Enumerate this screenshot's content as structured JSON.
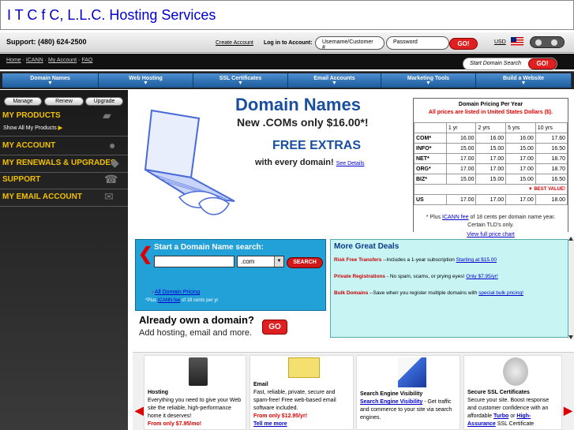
{
  "window": {
    "title": "I T C f C, L.L.C. Hosting Services"
  },
  "topbar": {
    "support": "Support: (480) 624-2500",
    "create_account": "Create Account",
    "login_label": "Log in to Account:",
    "username_placeholder": "Username/Customer #",
    "password_placeholder": "Password",
    "go_label": "GO!",
    "currency": "USD"
  },
  "breadcrumbs": {
    "home": "Home",
    "icann": "ICANN",
    "my_account": "My Account",
    "faq": "FAQ"
  },
  "domain_search_pill": {
    "label": "Start Domain Search",
    "go": "GO!"
  },
  "menu": [
    {
      "label": "Domain Names"
    },
    {
      "label": "Web Hosting"
    },
    {
      "label": "SSL Certificates"
    },
    {
      "label": "Email Accounts"
    },
    {
      "label": "Marketing Tools"
    },
    {
      "label": "Build a Website"
    }
  ],
  "sidebar": {
    "buttons": [
      "Manage",
      "Renew",
      "Upgrade"
    ],
    "my_products": "MY PRODUCTS",
    "show_all": "Show All My Products",
    "my_account": "MY ACCOUNT",
    "renewals": "MY RENEWALS & UPGRADES",
    "support": "SUPPORT",
    "email": "MY EMAIL ACCOUNT"
  },
  "hero": {
    "title": "Domain Names",
    "subtitle": "New .COMs only $16.00*!",
    "free": "FREE EXTRAS",
    "free_sub": "with every domain!",
    "see_details": "See Details"
  },
  "pricing": {
    "title": "Domain Pricing Per Year",
    "subtitle": "All prices are listed in United States Dollars ($).",
    "columns": [
      "1 yr",
      "2 yrs",
      "5 yrs",
      "10 yrs"
    ],
    "rows": [
      {
        "tld": "COM*",
        "p": [
          "16.00",
          "16.00",
          "16.00",
          "17.60"
        ]
      },
      {
        "tld": "INFO*",
        "p": [
          "15.00",
          "15.00",
          "15.00",
          "16.50"
        ]
      },
      {
        "tld": "NET*",
        "p": [
          "17.00",
          "17.00",
          "17.00",
          "18.70"
        ]
      },
      {
        "tld": "ORG*",
        "p": [
          "17.00",
          "17.00",
          "17.00",
          "18.70"
        ]
      },
      {
        "tld": "BIZ*",
        "p": [
          "15.00",
          "15.00",
          "15.00",
          "16.50"
        ]
      },
      {
        "tld": "US",
        "p": [
          "17.00",
          "17.00",
          "17.00",
          "18.00"
        ]
      }
    ],
    "best_value": "BEST VALUE!",
    "note_prefix": "* Plus",
    "note_link": "ICANN fee",
    "note_suffix": "of 18 cents per domain name year.",
    "note_2": "Certain TLD's only.",
    "view_all": "View full price chart"
  },
  "search": {
    "title": "Start a Domain Name search:",
    "tld": ".com",
    "button": "SEARCH",
    "all_pricing": "All Domain Pricing",
    "icann_prefix": "*Plus",
    "icann_link": "ICANN fee",
    "icann_suffix": "of 18 cents per yr"
  },
  "already": {
    "title": "Already own a domain?",
    "sub": "Add hosting, email and more.",
    "go": "GO"
  },
  "deals": {
    "title": "More Great Deals",
    "items": [
      {
        "name": "Risk Free Transfers",
        "text": "--Includes a 1-year subscription",
        "link": "Starting at $15.00"
      },
      {
        "name": "Private Registrations",
        "text": "- No spam, scams, or prying eyes!",
        "link": "Only $7.95/yr!"
      },
      {
        "name": "Bulk Domains",
        "text": "--Save when you register multiple domains with",
        "link": "special bulk pricing!"
      }
    ]
  },
  "cards": [
    {
      "title": "Hosting",
      "text": "Everything you need to give your Web site the reliable, high-performance home it deserves!",
      "promo": "From only $7.95/mo!"
    },
    {
      "title": "Email",
      "text": "Fast, reliable, private, secure and spam-free! Free web-based email software included.",
      "promo": "From only $12.95/yr!",
      "link": "Tell me more"
    },
    {
      "title": "Search Engine Visibility",
      "link": "Search Engine Visibility",
      "text": "- Get traffic and commerce to your site via search engines."
    },
    {
      "title": "Secure SSL Certificates",
      "text": "Secure your site. Boost response and customer confidence with an affordable",
      "link": "Turbo",
      "mid": "or",
      "link2": "High-Assurance",
      "tail": "SSL Certificate"
    }
  ]
}
